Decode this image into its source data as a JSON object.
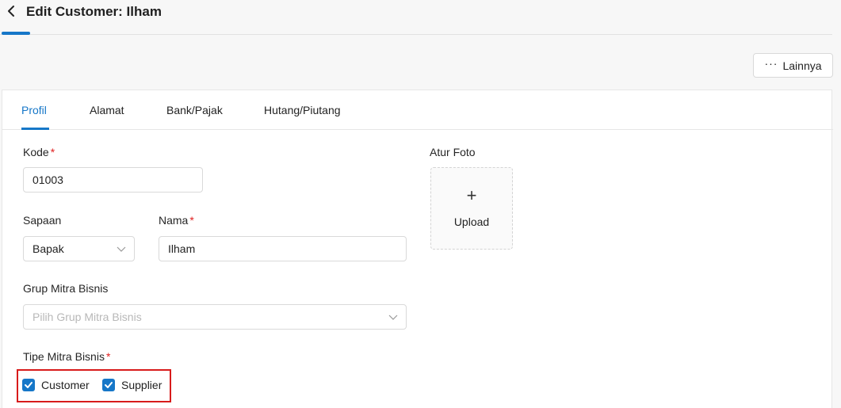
{
  "header": {
    "title": "Edit Customer: Ilham",
    "more_label": "Lainnya"
  },
  "tabs": [
    {
      "label": "Profil",
      "active": true
    },
    {
      "label": "Alamat",
      "active": false
    },
    {
      "label": "Bank/Pajak",
      "active": false
    },
    {
      "label": "Hutang/Piutang",
      "active": false
    }
  ],
  "form": {
    "kode": {
      "label": "Kode",
      "value": "01003",
      "required": true
    },
    "sapaan": {
      "label": "Sapaan",
      "value": "Bapak"
    },
    "nama": {
      "label": "Nama",
      "value": "Ilham",
      "required": true
    },
    "grup": {
      "label": "Grup Mitra Bisnis",
      "placeholder": "Pilih Grup Mitra Bisnis"
    },
    "tipe": {
      "label": "Tipe Mitra Bisnis",
      "required": true,
      "options": [
        {
          "label": "Customer",
          "checked": true
        },
        {
          "label": "Supplier",
          "checked": true
        }
      ]
    }
  },
  "photo": {
    "label": "Atur Foto",
    "plus": "+",
    "upload_label": "Upload"
  },
  "colors": {
    "accent": "#1677c8",
    "required": "#e02020",
    "highlight": "#d81b1b"
  }
}
